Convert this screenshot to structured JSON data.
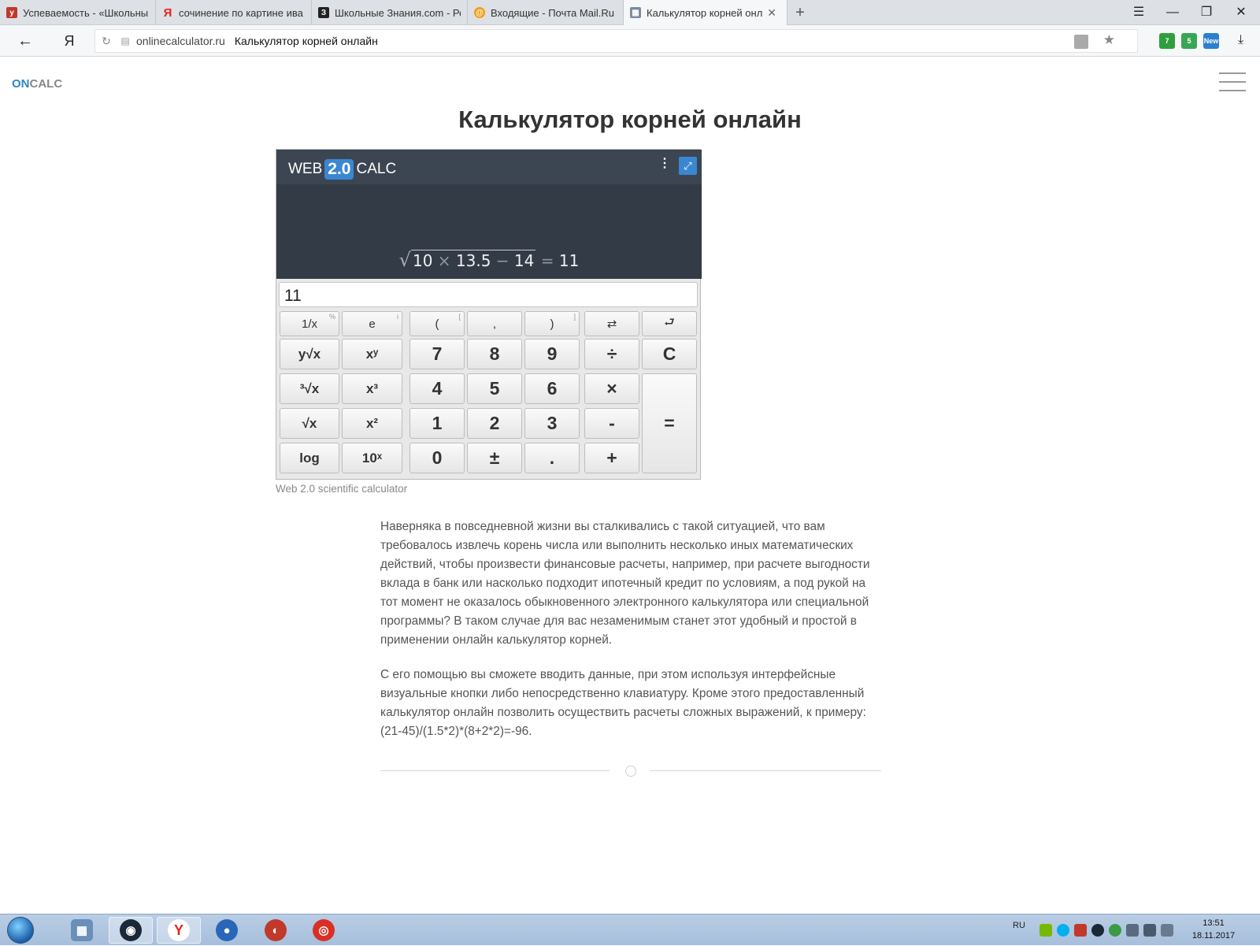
{
  "browser": {
    "tabs": [
      {
        "title": "Успеваемость - «Школьный",
        "favicon": "school-icon",
        "color": "#c0392b"
      },
      {
        "title": "сочинение по картине ива",
        "favicon": "yandex-icon",
        "color": "#e52620"
      },
      {
        "title": "Школьные Знания.com - Ре",
        "favicon": "znanija-icon",
        "color": "#222222"
      },
      {
        "title": "Входящие - Почта Mail.Ru",
        "favicon": "mail-icon",
        "color": "#168de2"
      },
      {
        "title": "Калькулятор корней онл",
        "favicon": "calculator-icon",
        "color": "#5a6a80"
      }
    ],
    "active_tab": 4,
    "new_tab": "+",
    "address": {
      "domain": "onlinecalculator.ru",
      "page_title": "Калькулятор корней онлайн"
    },
    "back": "←",
    "yandex": "Я",
    "extensions": [
      {
        "badge": "7",
        "color": "#2f9e3f"
      },
      {
        "badge": "5",
        "color": "#3aa655"
      },
      {
        "badge": "New",
        "color": "#2b7fd0"
      }
    ]
  },
  "site": {
    "logo_on": "ON",
    "logo_calc": "CALC",
    "title": "Калькулятор корней онлайн"
  },
  "calculator": {
    "brand_left": "WEB",
    "brand_version": "2.0",
    "brand_right": "CALC",
    "expression": {
      "radicand_parts": [
        "10",
        "×",
        "13.5",
        "−",
        "14"
      ],
      "equals": "=",
      "result": "11"
    },
    "input_value": "11",
    "keys": {
      "row0": [
        "1/x",
        "e",
        "(",
        ",",
        ")",
        "⇄",
        "⮐"
      ],
      "row0_secondary": [
        "%",
        "i",
        "[",
        "",
        "]",
        "",
        ""
      ],
      "row1": [
        "y√x",
        "xʸ",
        "7",
        "8",
        "9",
        "÷",
        "C"
      ],
      "row2": [
        "³√x",
        "x³",
        "4",
        "5",
        "6",
        "×"
      ],
      "row3": [
        "√x",
        "x²",
        "1",
        "2",
        "3",
        "-"
      ],
      "row4": [
        "log",
        "10ˣ",
        "0",
        "±",
        ".",
        "+"
      ],
      "equals": "="
    },
    "caption": "Web 2.0 scientific calculator"
  },
  "article": {
    "paragraphs": [
      "Наверняка в повседневной жизни вы сталкивались с такой ситуацией, что вам требовалось извлечь корень числа или выполнить несколько иных математических действий, чтобы произвести финансовые расчеты, например, при расчете выгодности вклада в банк или насколько подходит ипотечный кредит по условиям, а под рукой на тот момент не оказалось обыкновенного электронного калькулятора или специальной программы? В таком случае для вас незаменимым станет этот удобный и простой в применении онлайн калькулятор корней.",
      "С его помощью вы сможете вводить данные, при этом используя интерфейсные визуальные кнопки либо непосредственно клавиатуру. Кроме этого предоставленный калькулятор онлайн позволить осуществить расчеты сложных выражений, к примеру: (21-45)/(1.5*2)*(8+2*2)=-96."
    ]
  },
  "taskbar": {
    "apps": [
      {
        "name": "calculator",
        "label": "▦",
        "color": "#6a8fb8"
      },
      {
        "name": "steam",
        "label": "◉",
        "color": "#1b2838"
      },
      {
        "name": "yandex-browser",
        "label": "Y",
        "color": "#e52620"
      },
      {
        "name": "firefox",
        "label": "●",
        "color": "#2a66b8"
      },
      {
        "name": "game",
        "label": "◐",
        "color": "#c0392b"
      },
      {
        "name": "chrome",
        "label": "◎",
        "color": "#d93025"
      }
    ],
    "lang": "RU",
    "time": "13:51",
    "date": "18.11.2017"
  }
}
